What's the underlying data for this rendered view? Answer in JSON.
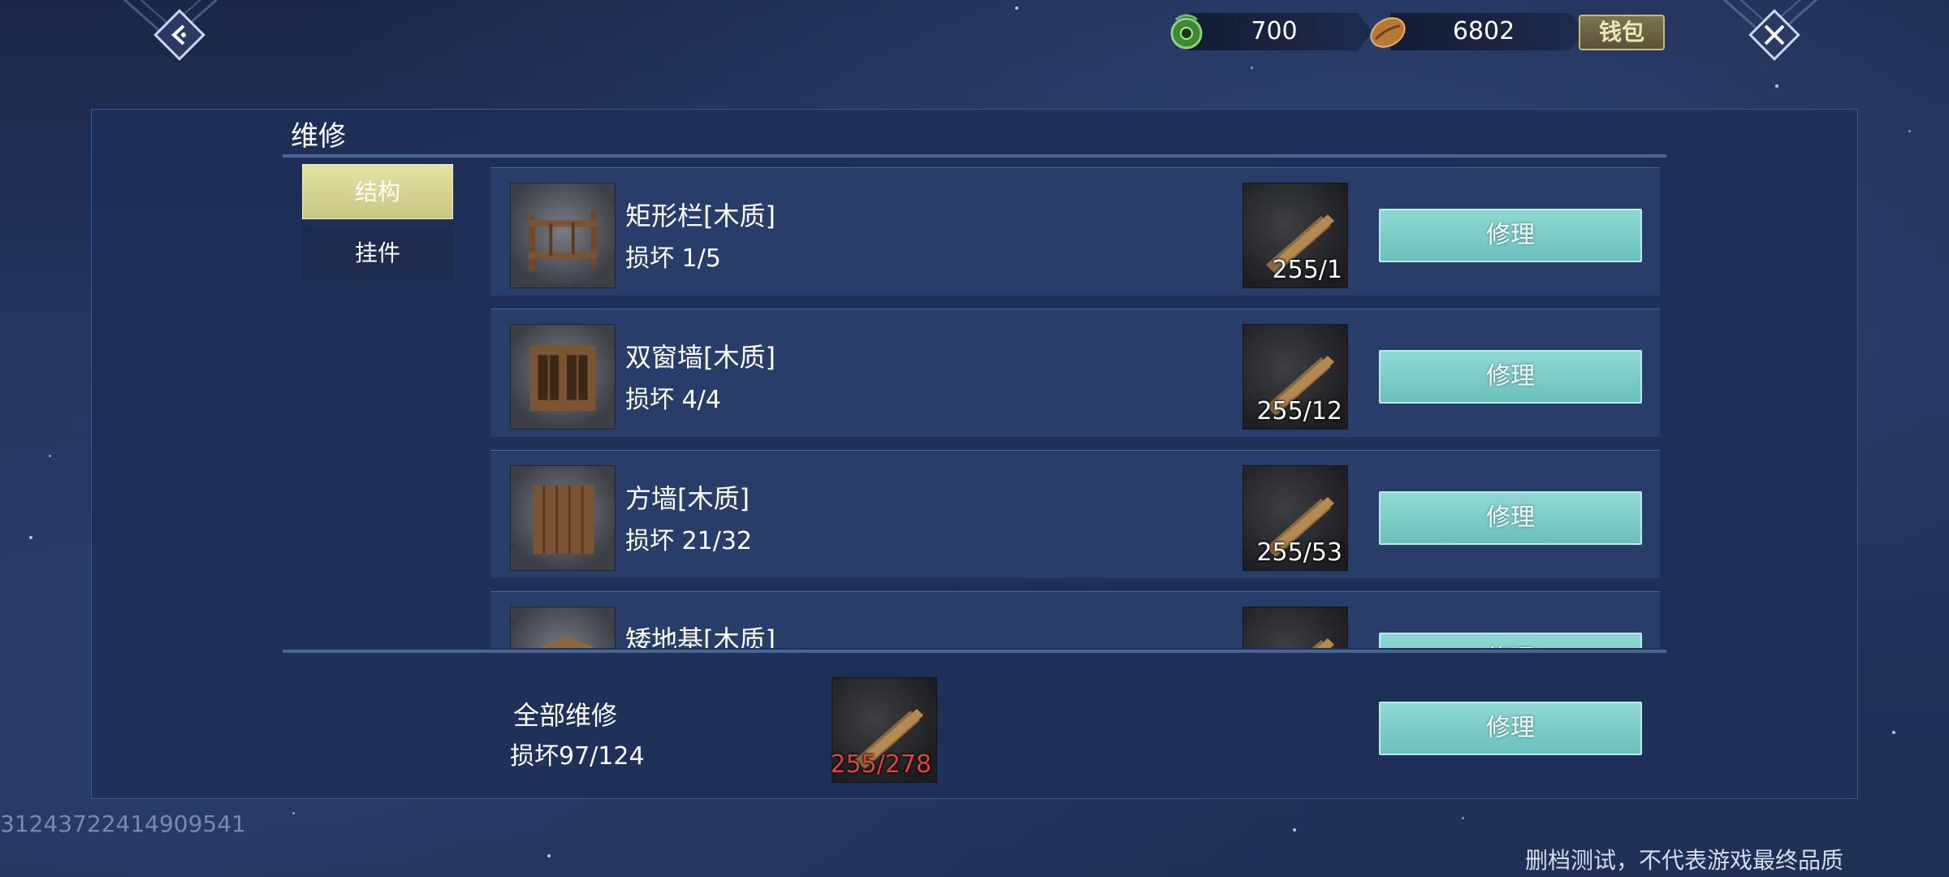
{
  "currencies": {
    "jade": {
      "icon": "jade-coin-icon",
      "value": "700"
    },
    "coin": {
      "icon": "bean-coin-icon",
      "value": "6802"
    }
  },
  "wallet_label": "钱包",
  "panel": {
    "title": "维修",
    "tabs": [
      {
        "label": "结构",
        "active": true
      },
      {
        "label": "挂件",
        "active": false
      }
    ],
    "items": [
      {
        "name": "矩形栏[木质]",
        "damage": "损坏 1/5",
        "material_count": "255/1",
        "button": "修理"
      },
      {
        "name": "双窗墙[木质]",
        "damage": "损坏 4/4",
        "material_count": "255/12",
        "button": "修理"
      },
      {
        "name": "方墙[木质]",
        "damage": "损坏 21/32",
        "material_count": "255/53",
        "button": "修理"
      },
      {
        "name": "矮地基[木质]",
        "damage": "",
        "material_count": "",
        "button": "修理"
      }
    ],
    "repair_all": {
      "title": "全部维修",
      "damage": "损坏97/124",
      "material_count": "255/278",
      "button": "修理"
    }
  },
  "build_id": "31243722414909541",
  "disclaimer": "删档测试，不代表游戏最终品质",
  "colors": {
    "accent_teal": "#7fd0cb",
    "tab_active": "#d6d493",
    "insufficient_red": "#e0423c"
  }
}
